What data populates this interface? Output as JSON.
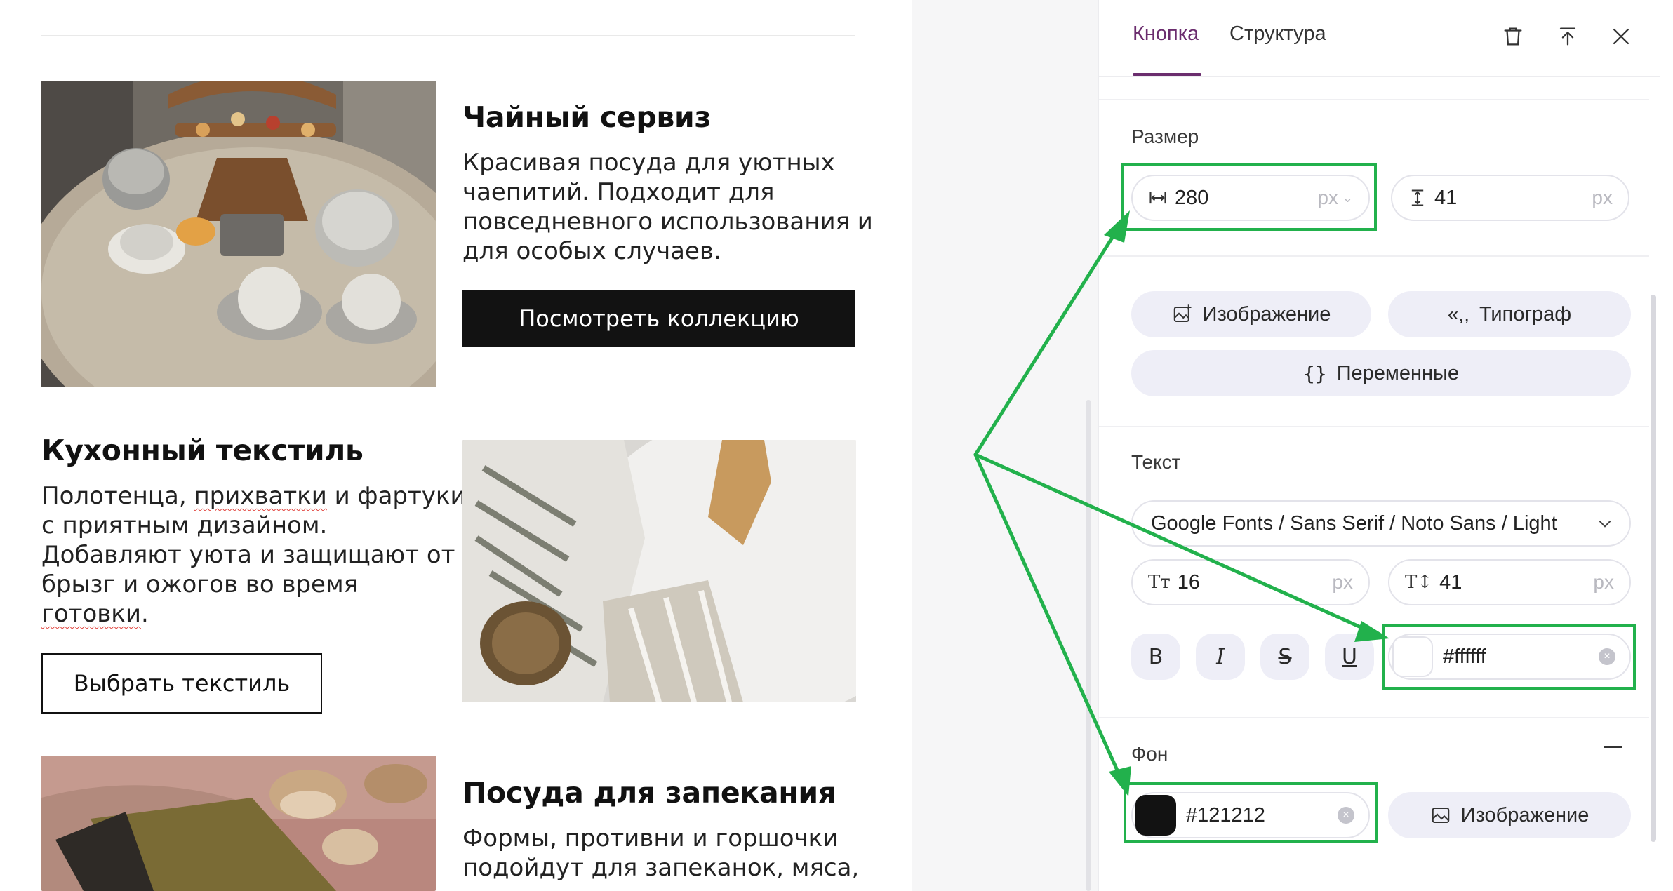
{
  "preview": {
    "blocks": [
      {
        "title": "Чайный сервиз",
        "text": [
          "Красивая посуда для уютных",
          "чаепитий. Подходит для",
          "повседневного использования и",
          "для особых случаев."
        ],
        "button": "Посмотреть коллекцию"
      },
      {
        "title": "Кухонный текстиль",
        "text_parts": {
          "line1a": "Полотенца, ",
          "line1b": "прихватки",
          "line1c": " и фартуки",
          "line2": "с приятным дизайном.",
          "line3": "Добавляют уюта и защищают от",
          "line4": "брызг и ожогов во время",
          "line5": "готовки",
          "line5end": "."
        },
        "button": "Выбрать текстиль"
      },
      {
        "title": "Посуда для запекания",
        "text": [
          "Формы, противни и горшочки",
          "подойдут для запеканок, мяса,"
        ]
      }
    ]
  },
  "panel": {
    "tabs": [
      "Кнопка",
      "Структура"
    ],
    "size": {
      "label": "Размер",
      "width_value": "280",
      "width_unit": "px",
      "height_value": "41",
      "height_unit": "px"
    },
    "actions": {
      "image": "Изображение",
      "typograph": "Типограф",
      "variables": "Переменные"
    },
    "text": {
      "label": "Текст",
      "font": "Google Fonts / Sans Serif / Noto Sans / Light",
      "font_size": "16",
      "font_size_unit": "px",
      "line_height": "41",
      "line_height_unit": "px",
      "style_buttons": [
        "B",
        "I",
        "S",
        "U"
      ],
      "color": "#ffffff"
    },
    "background": {
      "label": "Фон",
      "color": "#121212",
      "image_button": "Изображение"
    }
  },
  "colors": {
    "accent": "#6b2d6e",
    "button_bg": "#121212",
    "annotation": "#22b14c"
  }
}
